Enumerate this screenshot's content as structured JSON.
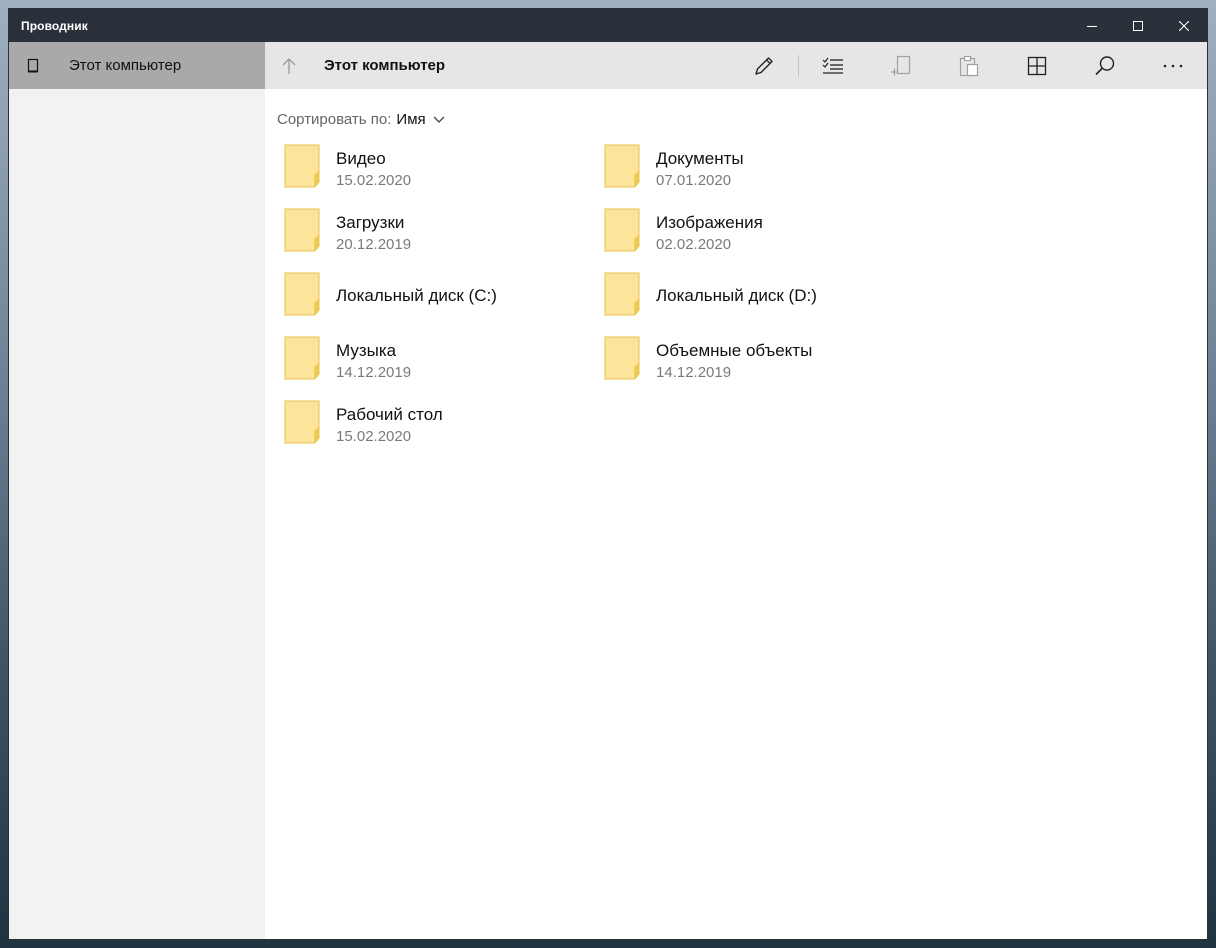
{
  "window": {
    "title": "Проводник"
  },
  "sidebar": {
    "items": [
      {
        "label": "Этот компьютер",
        "icon": "computer-icon",
        "selected": true
      }
    ]
  },
  "toolbar": {
    "location": "Этот компьютер",
    "icons": [
      "up-arrow-icon",
      "rename-pencil-icon",
      "select-checklist-icon",
      "new-folder-icon",
      "paste-clipboard-icon",
      "view-tiles-icon",
      "search-icon",
      "more-ellipsis-icon"
    ]
  },
  "sort": {
    "label": "Сортировать по:",
    "value": "Имя"
  },
  "items": [
    {
      "name": "Видео",
      "date": "15.02.2020"
    },
    {
      "name": "Документы",
      "date": "07.01.2020"
    },
    {
      "name": "Загрузки",
      "date": "20.12.2019"
    },
    {
      "name": "Изображения",
      "date": "02.02.2020"
    },
    {
      "name": "Локальный диск (C:)",
      "date": ""
    },
    {
      "name": "Локальный диск (D:)",
      "date": ""
    },
    {
      "name": "Музыка",
      "date": "14.12.2019"
    },
    {
      "name": "Объемные объекты",
      "date": "14.12.2019"
    },
    {
      "name": "Рабочий стол",
      "date": "15.02.2020"
    }
  ],
  "colors": {
    "titlebar": "#2b313a",
    "sidebar": "#f2f2f2",
    "sidebar_selected": "#a9a9a9",
    "toolbar": "#e6e6e6",
    "folder": "#fce49a",
    "folder_edge": "#e8c24d"
  }
}
